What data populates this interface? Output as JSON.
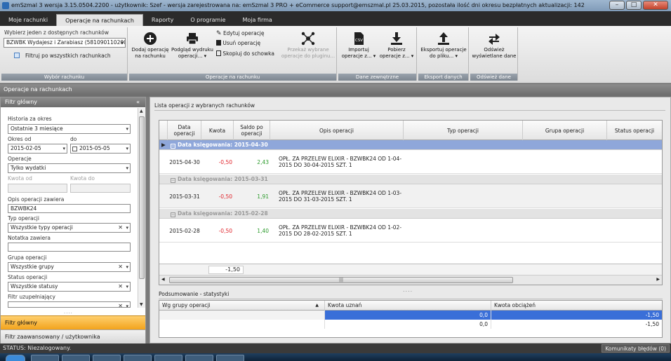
{
  "window": {
    "title": "emSzmal 3 wersja 3.15.0504.2200 - użytkownik: Szef - wersja zarejestrowana na: emSzmal 3 PRO + eCommerce support@emszmal.pl 25.03.2015, pozostała ilość dni okresu bezpłatnych aktualizacji: 142"
  },
  "menu": {
    "tabs": [
      "Moje rachunki",
      "Operacje na rachunkach",
      "Raporty",
      "O programie",
      "Moja firma"
    ]
  },
  "ribbon": {
    "account_group": {
      "label": "Wybierz jeden z dostępnych rachunków",
      "selected": "BZWBK Wydajesz i Zarabiasz (581090110200...",
      "filter_all": "Filtruj po wszystkich rachunkach",
      "caption": "Wybór rachunku"
    },
    "ops_group": {
      "add": "Dodaj operację na rachunku",
      "print": "Podgląd wydruku operacji... ▾",
      "edit": "Edytuj operację",
      "delete": "Usuń operację",
      "copy": "Skopiuj do schowka",
      "plugin": "Przekaż wybrane operacje do pluginu...",
      "caption": "Operacje na rachunku"
    },
    "ext_group": {
      "import": "Importuj operacje z... ▾",
      "fetch": "Pobierz operacje z... ▾",
      "caption": "Dane zewnętrzne"
    },
    "export_group": {
      "export": "Eksportuj operacje do pliku... ▾",
      "caption": "Eksport danych"
    },
    "refresh_group": {
      "refresh": "Odśwież wyświetlane dane",
      "caption": "Odśwież dane"
    }
  },
  "section_title": "Operacje na rachunkach",
  "filter": {
    "header": "Filtr główny",
    "history_label": "Historia za okres",
    "history_value": "Ostatnie 3 miesiące",
    "date_from_label": "Okres od",
    "date_to_label": "do",
    "date_from": "2015-02-05",
    "date_to": "2015-05-05",
    "ops_label": "Operacje",
    "ops_value": "Tylko wydatki",
    "amount_from_label": "Kwota od",
    "amount_to_label": "Kwota do",
    "desc_label": "Opis operacji zawiera",
    "desc_value": "BZWBK24",
    "type_label": "Typ operacji",
    "type_value": "Wszystkie typy operacji",
    "note_label": "Notatka zawiera",
    "note_value": "",
    "group_label": "Grupa operacji",
    "group_value": "Wszystkie grupy",
    "status_label": "Status operacji",
    "status_value": "Wszystkie statusy",
    "extra_label": "Filtr uzupełniający",
    "extra_value": "",
    "tab_main": "Filtr główny",
    "tab_adv": "Filtr zaawansowany / użytkownika"
  },
  "grid": {
    "title": "Lista operacji z wybranych rachunków",
    "columns": [
      "Data operacji",
      "Kwota",
      "Saldo po operacji",
      "Opis operacji",
      "Typ operacji",
      "Grupa operacji",
      "Status operacji"
    ],
    "groups": [
      {
        "label": "Data księgowania: 2015-04-30",
        "rows": [
          {
            "date": "2015-04-30",
            "amount": "-0,50",
            "balance": "2,43",
            "desc": "OPŁ. ZA PRZELEW ELIXIR - BZWBK24 OD 1-04-2015 DO 30-04-2015 SZT. 1"
          }
        ]
      },
      {
        "label": "Data księgowania: 2015-03-31",
        "rows": [
          {
            "date": "2015-03-31",
            "amount": "-0,50",
            "balance": "1,91",
            "desc": "OPŁ. ZA PRZELEW ELIXIR - BZWBK24 OD 1-03-2015 DO 31-03-2015 SZT. 1"
          }
        ]
      },
      {
        "label": "Data księgowania: 2015-02-28",
        "rows": [
          {
            "date": "2015-02-28",
            "amount": "-0,50",
            "balance": "1,40",
            "desc": "OPŁ. ZA PRZELEW ELIXIR - BZWBK24 OD 1-02-2015 DO 28-02-2015 SZT. 1"
          }
        ]
      }
    ],
    "total": "-1,50"
  },
  "summary": {
    "title": "Podsumowanie - statystyki",
    "columns": [
      "Wg grupy operacji",
      "Kwota uznań",
      "Kwota obciążeń"
    ],
    "rows": [
      [
        "",
        "0,0",
        "-1,50"
      ],
      [
        "",
        "0,0",
        "-1,50"
      ]
    ]
  },
  "status": {
    "text": "STATUS: Niezalogowany.",
    "errors": "Komunikaty błędów (0)"
  }
}
